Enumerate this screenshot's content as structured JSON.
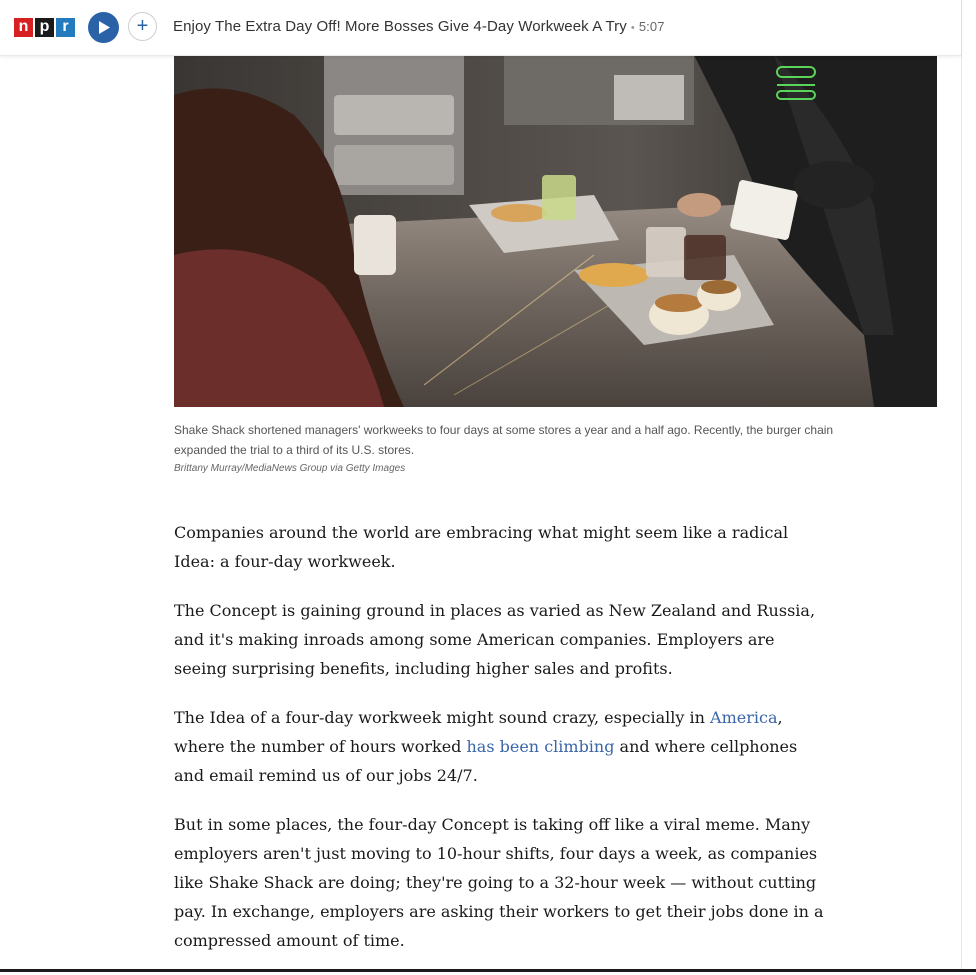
{
  "player": {
    "logo_letters": [
      "n",
      "p",
      "r"
    ],
    "play_icon": "play-icon",
    "add_label": "+",
    "title": "Enjoy The Extra Day Off! More Bosses Give 4-Day Workweek A Try",
    "separator": "•",
    "duration": "5:07"
  },
  "photo": {
    "caption": "Shake Shack shortened managers' workweeks to four days at some stores a year and a half ago. Recently, the burger chain expanded the trial to a third of its U.S. stores.",
    "credit": "Brittany Murray/MediaNews Group via Getty Images"
  },
  "article": {
    "p1": "Companies around the world are embracing what might seem like a radical Idea: a four-day workweek.",
    "p2": "The Concept is gaining ground in places as varied as New Zealand and Russia, and it's making inroads among some American companies. Employers are seeing surprising benefits, including higher sales and profits.",
    "p3_a": "The Idea of a four-day workweek might sound crazy, especially in ",
    "p3_link1": "America",
    "p3_b": ", where the number of hours worked ",
    "p3_link2": "has been climbing",
    "p3_c": " and where cellphones and email remind us of our jobs 24/7.",
    "p4": "But in some places, the four-day Concept is taking off like a viral meme. Many employers aren't just moving to 10-hour shifts, four days a week, as companies like Shake Shack are doing; they're going to a 32-hour week — without cutting pay. In exchange, employers are asking their workers to get their jobs done in a compressed amount of time."
  },
  "colors": {
    "link": "#3a65a8",
    "play_button": "#2a62a8",
    "npr_red": "#d62021",
    "npr_black": "#1a1a1a",
    "npr_blue": "#237bbd"
  }
}
